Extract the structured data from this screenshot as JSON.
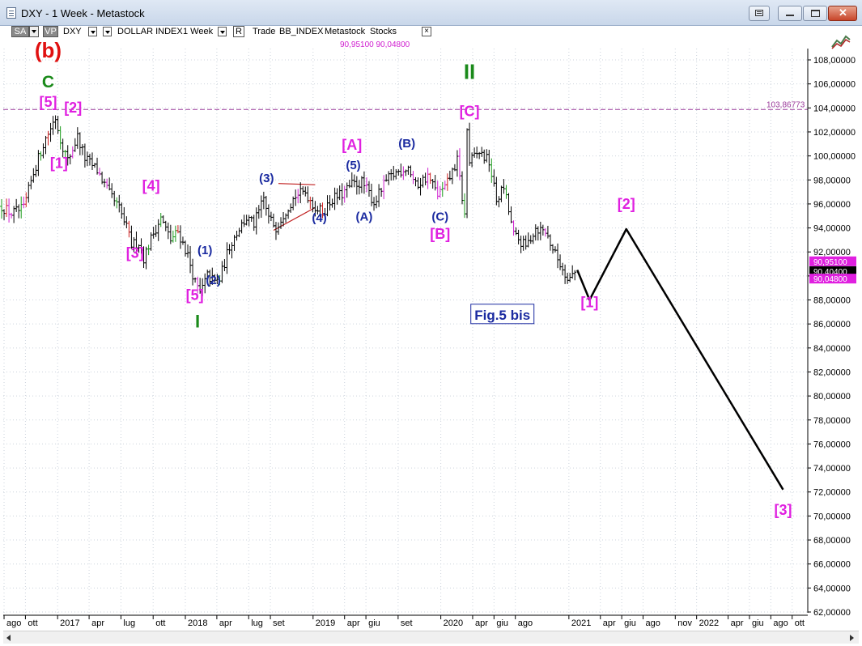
{
  "window": {
    "title": "DXY - 1 Week - Metastock"
  },
  "toolbar": {
    "sa": "SA",
    "vp": "VP",
    "symbol": "DXY",
    "name": "DOLLAR INDEX",
    "period": "1 Week",
    "mode": "R",
    "trade": "Trade",
    "source": "BB_INDEX",
    "provider": "Metastock",
    "category": "Stocks"
  },
  "quote": {
    "high": "90,95100",
    "low": "90,04800"
  },
  "chart_data": {
    "type": "candlestick",
    "xlabel": "",
    "ylabel": "",
    "y_range": [
      62,
      109
    ],
    "y_ticks": [
      "108,00000",
      "106,00000",
      "104,00000",
      "102,00000",
      "100,00000",
      "98,00000",
      "96,00000",
      "94,00000",
      "92,00000",
      "90,00000",
      "88,00000",
      "86,00000",
      "84,00000",
      "82,00000",
      "80,00000",
      "78,00000",
      "76,00000",
      "74,00000",
      "72,00000",
      "70,00000",
      "68,00000",
      "66,00000",
      "64,00000",
      "62,00000"
    ],
    "x_range": [
      "2016-07-25",
      "2022-11-10"
    ],
    "x_ticks": [
      {
        "date": "2016-08-01",
        "label": "ago"
      },
      {
        "date": "2016-10-01",
        "label": "ott"
      },
      {
        "date": "2017-01-01",
        "label": "2017"
      },
      {
        "date": "2017-04-01",
        "label": "apr"
      },
      {
        "date": "2017-07-01",
        "label": "lug"
      },
      {
        "date": "2017-10-01",
        "label": "ott"
      },
      {
        "date": "2018-01-01",
        "label": "2018"
      },
      {
        "date": "2018-04-01",
        "label": "apr"
      },
      {
        "date": "2018-07-01",
        "label": "lug"
      },
      {
        "date": "2018-09-01",
        "label": "set"
      },
      {
        "date": "2019-01-01",
        "label": "2019"
      },
      {
        "date": "2019-04-01",
        "label": "apr"
      },
      {
        "date": "2019-06-01",
        "label": "giu"
      },
      {
        "date": "2019-09-01",
        "label": "set"
      },
      {
        "date": "2020-01-01",
        "label": "2020"
      },
      {
        "date": "2020-04-01",
        "label": "apr"
      },
      {
        "date": "2020-06-01",
        "label": "giu"
      },
      {
        "date": "2020-08-01",
        "label": "ago"
      },
      {
        "date": "2021-01-01",
        "label": "2021"
      },
      {
        "date": "2021-04-01",
        "label": "apr"
      },
      {
        "date": "2021-06-01",
        "label": "giu"
      },
      {
        "date": "2021-08-01",
        "label": "ago"
      },
      {
        "date": "2021-11-01",
        "label": "nov"
      },
      {
        "date": "2022-01-01",
        "label": "2022"
      },
      {
        "date": "2022-04-01",
        "label": "apr"
      },
      {
        "date": "2022-06-01",
        "label": "giu"
      },
      {
        "date": "2022-08-01",
        "label": "ago"
      },
      {
        "date": "2022-10-01",
        "label": "ott"
      }
    ],
    "price_path": [
      [
        "2016-07-25",
        95.8
      ],
      [
        "2016-08-22",
        95.2
      ],
      [
        "2016-09-26",
        95.6
      ],
      [
        "2016-10-24",
        98.6
      ],
      [
        "2016-11-21",
        101.0
      ],
      [
        "2016-12-19",
        102.8
      ],
      [
        "2016-12-26",
        103.2
      ],
      [
        "2017-01-09",
        101.4
      ],
      [
        "2017-01-30",
        99.6
      ],
      [
        "2017-02-27",
        101.6
      ],
      [
        "2017-03-20",
        99.8
      ],
      [
        "2017-04-24",
        98.8
      ],
      [
        "2017-05-29",
        96.8
      ],
      [
        "2017-06-26",
        95.6
      ],
      [
        "2017-07-17",
        94.0
      ],
      [
        "2017-07-31",
        92.6
      ],
      [
        "2017-08-21",
        92.8
      ],
      [
        "2017-09-04",
        91.5
      ],
      [
        "2017-10-02",
        93.6
      ],
      [
        "2017-10-23",
        94.8
      ],
      [
        "2017-11-20",
        93.0
      ],
      [
        "2017-12-11",
        93.7
      ],
      [
        "2018-01-08",
        91.7
      ],
      [
        "2018-01-29",
        89.4
      ],
      [
        "2018-02-12",
        88.5
      ],
      [
        "2018-03-05",
        90.0
      ],
      [
        "2018-03-26",
        89.5
      ],
      [
        "2018-04-09",
        89.7
      ],
      [
        "2018-05-07",
        92.5
      ],
      [
        "2018-06-04",
        94.0
      ],
      [
        "2018-06-25",
        94.8
      ],
      [
        "2018-07-16",
        94.3
      ],
      [
        "2018-08-13",
        96.4
      ],
      [
        "2018-08-27",
        94.8
      ],
      [
        "2018-09-17",
        94.1
      ],
      [
        "2018-10-15",
        95.5
      ],
      [
        "2018-11-12",
        96.7
      ],
      [
        "2018-12-10",
        97.0
      ],
      [
        "2019-01-07",
        95.7
      ],
      [
        "2019-01-28",
        95.3
      ],
      [
        "2019-02-25",
        96.4
      ],
      [
        "2019-03-25",
        96.8
      ],
      [
        "2019-04-22",
        97.6
      ],
      [
        "2019-05-20",
        97.8
      ],
      [
        "2019-06-10",
        96.9
      ],
      [
        "2019-06-24",
        96.1
      ],
      [
        "2019-07-29",
        97.9
      ],
      [
        "2019-08-26",
        98.6
      ],
      [
        "2019-09-30",
        99.1
      ],
      [
        "2019-10-21",
        97.5
      ],
      [
        "2019-11-25",
        98.3
      ],
      [
        "2019-12-23",
        96.8
      ],
      [
        "2020-01-13",
        97.3
      ],
      [
        "2020-02-17",
        99.6
      ],
      [
        "2020-03-09",
        95.0
      ],
      [
        "2020-03-16",
        102.2
      ],
      [
        "2020-03-23",
        99.5
      ],
      [
        "2020-04-20",
        100.3
      ],
      [
        "2020-05-18",
        99.5
      ],
      [
        "2020-06-08",
        96.3
      ],
      [
        "2020-06-29",
        97.4
      ],
      [
        "2020-07-27",
        93.4
      ],
      [
        "2020-08-31",
        92.4
      ],
      [
        "2020-09-28",
        94.0
      ],
      [
        "2020-10-26",
        93.7
      ],
      [
        "2020-11-23",
        91.8
      ],
      [
        "2020-12-21",
        90.2
      ],
      [
        "2021-01-04",
        89.9
      ],
      [
        "2021-01-18",
        90.3
      ]
    ],
    "projection": [
      [
        "2021-01-25",
        90.5
      ],
      [
        "2021-03-01",
        88.0
      ],
      [
        "2021-06-14",
        93.9
      ],
      [
        "2022-09-05",
        72.2
      ]
    ],
    "reference_line": {
      "value": 103.86773,
      "label": "103,86773"
    },
    "price_tags": [
      {
        "value": 90.951,
        "label": "90,95100",
        "color": "#e020e0"
      },
      {
        "value": 90.4,
        "label": "90,40400",
        "color": "#000000"
      },
      {
        "value": 90.048,
        "label": "90,04800",
        "color": "#e020e0"
      }
    ],
    "triangle": [
      [
        [
          "2018-09-24",
          97.7
        ],
        [
          "2019-01-07",
          97.6
        ]
      ],
      [
        [
          "2018-09-10",
          93.8
        ],
        [
          "2019-01-07",
          95.7
        ]
      ]
    ],
    "annotations": [
      {
        "text": "(b)",
        "date": "2016-12-05",
        "value": 108.2,
        "color": "#e01010",
        "size": 26
      },
      {
        "text": "C",
        "date": "2016-12-05",
        "value": 105.7,
        "color": "#1a8a1a",
        "size": 21
      },
      {
        "text": "[5]",
        "date": "2016-12-05",
        "value": 104.1,
        "color": "#e020e0",
        "size": 18
      },
      {
        "text": "[2]",
        "date": "2017-02-14",
        "value": 103.6,
        "color": "#e020e0",
        "size": 18
      },
      {
        "text": "[1]",
        "date": "2017-01-05",
        "value": 99.0,
        "color": "#e020e0",
        "size": 18
      },
      {
        "text": "[4]",
        "date": "2017-09-25",
        "value": 97.1,
        "color": "#e020e0",
        "size": 18
      },
      {
        "text": "[3]",
        "date": "2017-08-10",
        "value": 91.5,
        "color": "#e020e0",
        "size": 18
      },
      {
        "text": "(1)",
        "date": "2018-02-26",
        "value": 91.8,
        "color": "#1a2aa0",
        "size": 15
      },
      {
        "text": "(2)",
        "date": "2018-03-22",
        "value": 89.3,
        "color": "#1a2aa0",
        "size": 15
      },
      {
        "text": "[5]",
        "date": "2018-01-28",
        "value": 88.0,
        "color": "#e020e0",
        "size": 18
      },
      {
        "text": "I",
        "date": "2018-02-05",
        "value": 85.7,
        "color": "#1a8a1a",
        "size": 22
      },
      {
        "text": "(3)",
        "date": "2018-08-21",
        "value": 97.8,
        "color": "#1a2aa0",
        "size": 15
      },
      {
        "text": "(4)",
        "date": "2019-01-19",
        "value": 94.5,
        "color": "#1a2aa0",
        "size": 15
      },
      {
        "text": "(5)",
        "date": "2019-04-26",
        "value": 98.9,
        "color": "#1a2aa0",
        "size": 15
      },
      {
        "text": "[A]",
        "date": "2019-04-22",
        "value": 100.5,
        "color": "#e020e0",
        "size": 18
      },
      {
        "text": "(A)",
        "date": "2019-05-27",
        "value": 94.6,
        "color": "#1a2aa0",
        "size": 15
      },
      {
        "text": "(B)",
        "date": "2019-09-26",
        "value": 100.7,
        "color": "#1a2aa0",
        "size": 15
      },
      {
        "text": "(C)",
        "date": "2019-12-30",
        "value": 94.6,
        "color": "#1a2aa0",
        "size": 15
      },
      {
        "text": "[B]",
        "date": "2019-12-30",
        "value": 93.1,
        "color": "#e020e0",
        "size": 18
      },
      {
        "text": "II",
        "date": "2020-03-23",
        "value": 106.4,
        "color": "#1a8a1a",
        "size": 26
      },
      {
        "text": "[C]",
        "date": "2020-03-23",
        "value": 103.3,
        "color": "#e020e0",
        "size": 18
      },
      {
        "text": "[2]",
        "date": "2021-06-14",
        "value": 95.6,
        "color": "#e020e0",
        "size": 18
      },
      {
        "text": "[1]",
        "date": "2021-03-01",
        "value": 87.4,
        "color": "#e020e0",
        "size": 18
      },
      {
        "text": "[3]",
        "date": "2022-09-05",
        "value": 70.1,
        "color": "#e020e0",
        "size": 18
      }
    ],
    "figure_label": {
      "text": "Fig.5 bis",
      "date": "2020-06-25",
      "value": 86.7,
      "color": "#1a2aa0"
    }
  }
}
